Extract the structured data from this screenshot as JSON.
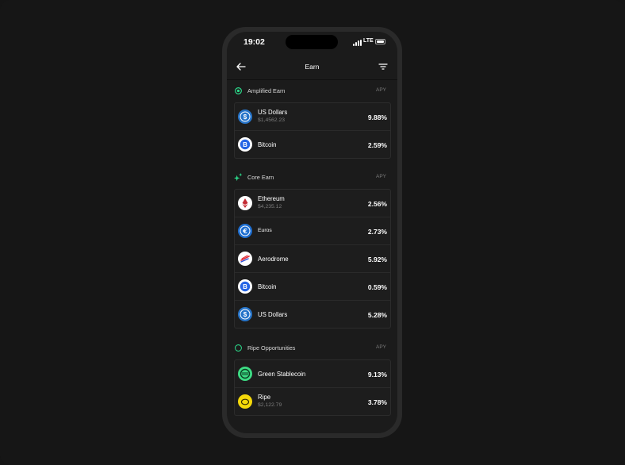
{
  "status": {
    "time": "19:02",
    "network": "LTE"
  },
  "nav": {
    "title": "Earn",
    "back_icon": "arrow-left-icon",
    "filter_icon": "filter-icon"
  },
  "sections": [
    {
      "title": "Amplified Earn",
      "apy_label": "APY",
      "icon": "target-icon",
      "accent": "#2bd98a",
      "items": [
        {
          "name": "US Dollars",
          "sub": "$1,4562.23",
          "apy": "9.88%",
          "icon": "usdc-icon"
        },
        {
          "name": "Bitcoin",
          "sub": "",
          "apy": "2.59%",
          "icon": "bitcoin-icon"
        }
      ]
    },
    {
      "title": "Core Earn",
      "apy_label": "APY",
      "icon": "sparkle-icon",
      "accent": "#2bd98a",
      "items": [
        {
          "name": "Ethereum",
          "sub": "$4,235.12",
          "apy": "2.56%",
          "icon": "ethereum-icon"
        },
        {
          "name": "Euros",
          "sub": "",
          "apy": "2.73%",
          "icon": "euro-coin-icon"
        },
        {
          "name": "Aerodrome",
          "sub": "",
          "apy": "5.92%",
          "icon": "aerodrome-icon"
        },
        {
          "name": "Bitcoin",
          "sub": "",
          "apy": "0.59%",
          "icon": "bitcoin-icon"
        },
        {
          "name": "US Dollars",
          "sub": "",
          "apy": "5.28%",
          "icon": "usdc-icon"
        }
      ]
    },
    {
      "title": "Ripe Opportunities",
      "apy_label": "APY",
      "icon": "ring-icon",
      "accent": "#2bd98a",
      "items": [
        {
          "name": "Green Stablecoin",
          "sub": "",
          "apy": "9.13%",
          "icon": "green-stablecoin-icon"
        },
        {
          "name": "Ripe",
          "sub": "$2,122.79",
          "apy": "3.78%",
          "icon": "ripe-icon"
        }
      ]
    }
  ]
}
